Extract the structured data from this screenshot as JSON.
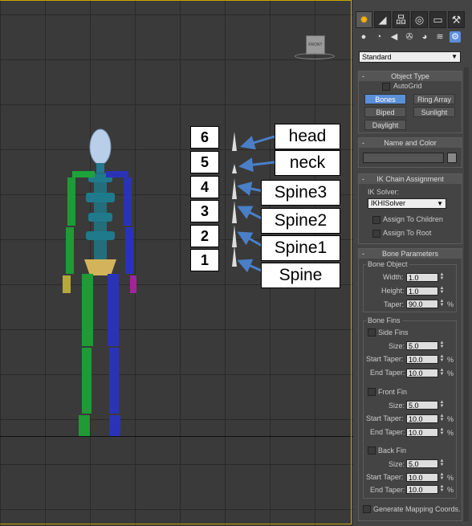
{
  "viewport": {
    "callouts": [
      {
        "num": "6",
        "label": "head"
      },
      {
        "num": "5",
        "label": "neck"
      },
      {
        "num": "4",
        "label": "Spine3"
      },
      {
        "num": "3",
        "label": "Spine2"
      },
      {
        "num": "2",
        "label": "Spine1"
      },
      {
        "num": "1",
        "label": "Spine"
      }
    ],
    "viewcube_label": "FRONT"
  },
  "panel": {
    "tabs": [
      "create-icon",
      "modify-icon",
      "hierarchy-icon",
      "motion-icon",
      "display-icon",
      "utilities-icon"
    ],
    "subtabs": [
      "geometry-icon",
      "shapes-icon",
      "lights-icon",
      "cameras-icon",
      "helpers-icon",
      "spacewarps-icon",
      "systems-icon"
    ],
    "category": "Standard",
    "object_type": {
      "title": "Object Type",
      "autogrid": "AutoGrid",
      "buttons": [
        "Bones",
        "Ring Array",
        "Biped",
        "Sunlight",
        "Daylight"
      ]
    },
    "name_color": {
      "title": "Name and Color"
    },
    "ik_chain": {
      "title": "IK Chain Assignment",
      "solver_label": "IK Solver:",
      "solver_value": "IKHISolver",
      "assign_children": "Assign To Children",
      "assign_root": "Assign To Root"
    },
    "bone_params": {
      "title": "Bone Parameters",
      "bone_object": "Bone Object",
      "width_label": "Width:",
      "width": "1.0",
      "height_label": "Height:",
      "height": "1.0",
      "taper_label": "Taper:",
      "taper": "90.0",
      "bone_fins": "Bone Fins",
      "side_fins": "Side Fins",
      "front_fin": "Front Fin",
      "back_fin": "Back Fin",
      "size_label": "Size:",
      "start_taper_label": "Start Taper:",
      "end_taper_label": "End Taper:",
      "size": "5.0",
      "taper_val": "10.0",
      "pct": "%",
      "gen_mapping": "Generate Mapping Coords."
    }
  }
}
